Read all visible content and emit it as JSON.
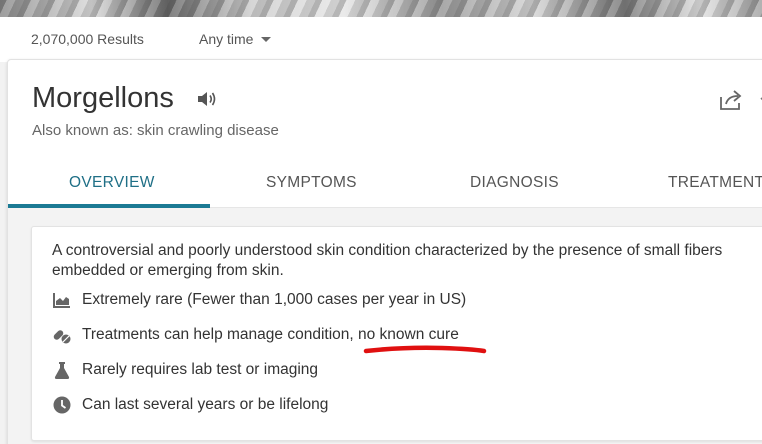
{
  "results": {
    "count": "2,070,000 Results",
    "time_filter": "Any time"
  },
  "condition": {
    "name": "Morgellons",
    "aka": "Also known as: skin crawling disease"
  },
  "tabs": [
    {
      "label": "OVERVIEW",
      "active": true
    },
    {
      "label": "SYMPTOMS",
      "active": false
    },
    {
      "label": "DIAGNOSIS",
      "active": false
    },
    {
      "label": "TREATMENT",
      "active": false
    }
  ],
  "overview": {
    "description": "A controversial and poorly understood skin condition characterized by the presence of small fibers embedded or emerging from skin.",
    "facts": [
      {
        "icon": "chart-icon",
        "text": "Extremely rare (Fewer than 1,000 cases per year in US)"
      },
      {
        "icon": "pills-icon",
        "text": "Treatments can help manage condition, no known cure"
      },
      {
        "icon": "flask-icon",
        "text": "Rarely requires lab test or imaging"
      },
      {
        "icon": "clock-icon",
        "text": "Can last several years or be lifelong"
      }
    ]
  },
  "colors": {
    "accent": "#1b7a94",
    "annotation": "#e01010"
  }
}
